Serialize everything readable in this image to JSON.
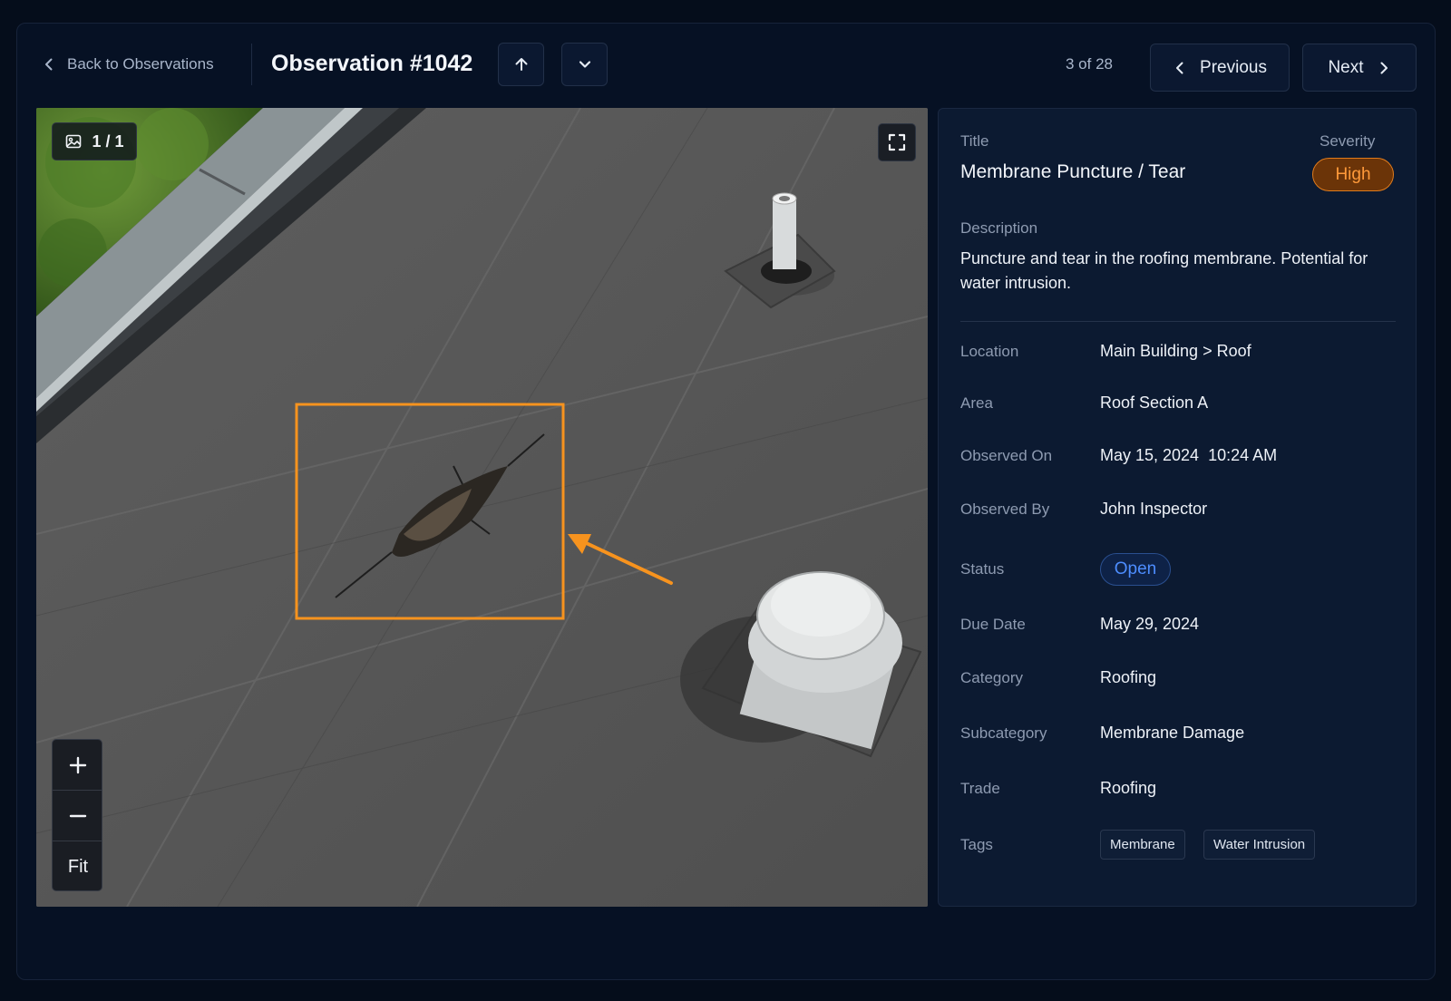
{
  "header": {
    "back_label": "Back to Observations",
    "title": "Observation #1042",
    "counter": "3 of 28",
    "previous_label": "Previous",
    "next_label": "Next"
  },
  "viewer": {
    "image_counter": "1 / 1",
    "zoom_in_icon": "plus-icon",
    "zoom_out_icon": "minus-icon",
    "fit_label": "Fit",
    "annotation_color": "#f7931e"
  },
  "detail": {
    "title_label": "Title",
    "title_value": "Membrane Puncture / Tear",
    "severity_label": "Severity",
    "severity_value": "High",
    "description_label": "Description",
    "description_value": "Puncture and tear in the roofing membrane. Potential for water intrusion.",
    "fields": [
      {
        "label": "Location",
        "value": "Main Building > Roof"
      },
      {
        "label": "Area",
        "value": "Roof Section A"
      },
      {
        "label": "Observed On",
        "value": "May 15, 2024  10:24 AM"
      },
      {
        "label": "Observed By",
        "value": "John Inspector"
      },
      {
        "label": "Status",
        "value": "Open"
      },
      {
        "label": "Due Date",
        "value": "May 29, 2024"
      },
      {
        "label": "Category",
        "value": "Roofing"
      },
      {
        "label": "Subcategory",
        "value": "Membrane Damage"
      },
      {
        "label": "Trade",
        "value": "Roofing"
      },
      {
        "label": "Tags",
        "value": ""
      }
    ],
    "tags": [
      "Membrane",
      "Water Intrusion"
    ]
  },
  "colors": {
    "severity_high": "#ff9a3a",
    "status_open": "#4d8dff",
    "background": "#050d1b"
  }
}
